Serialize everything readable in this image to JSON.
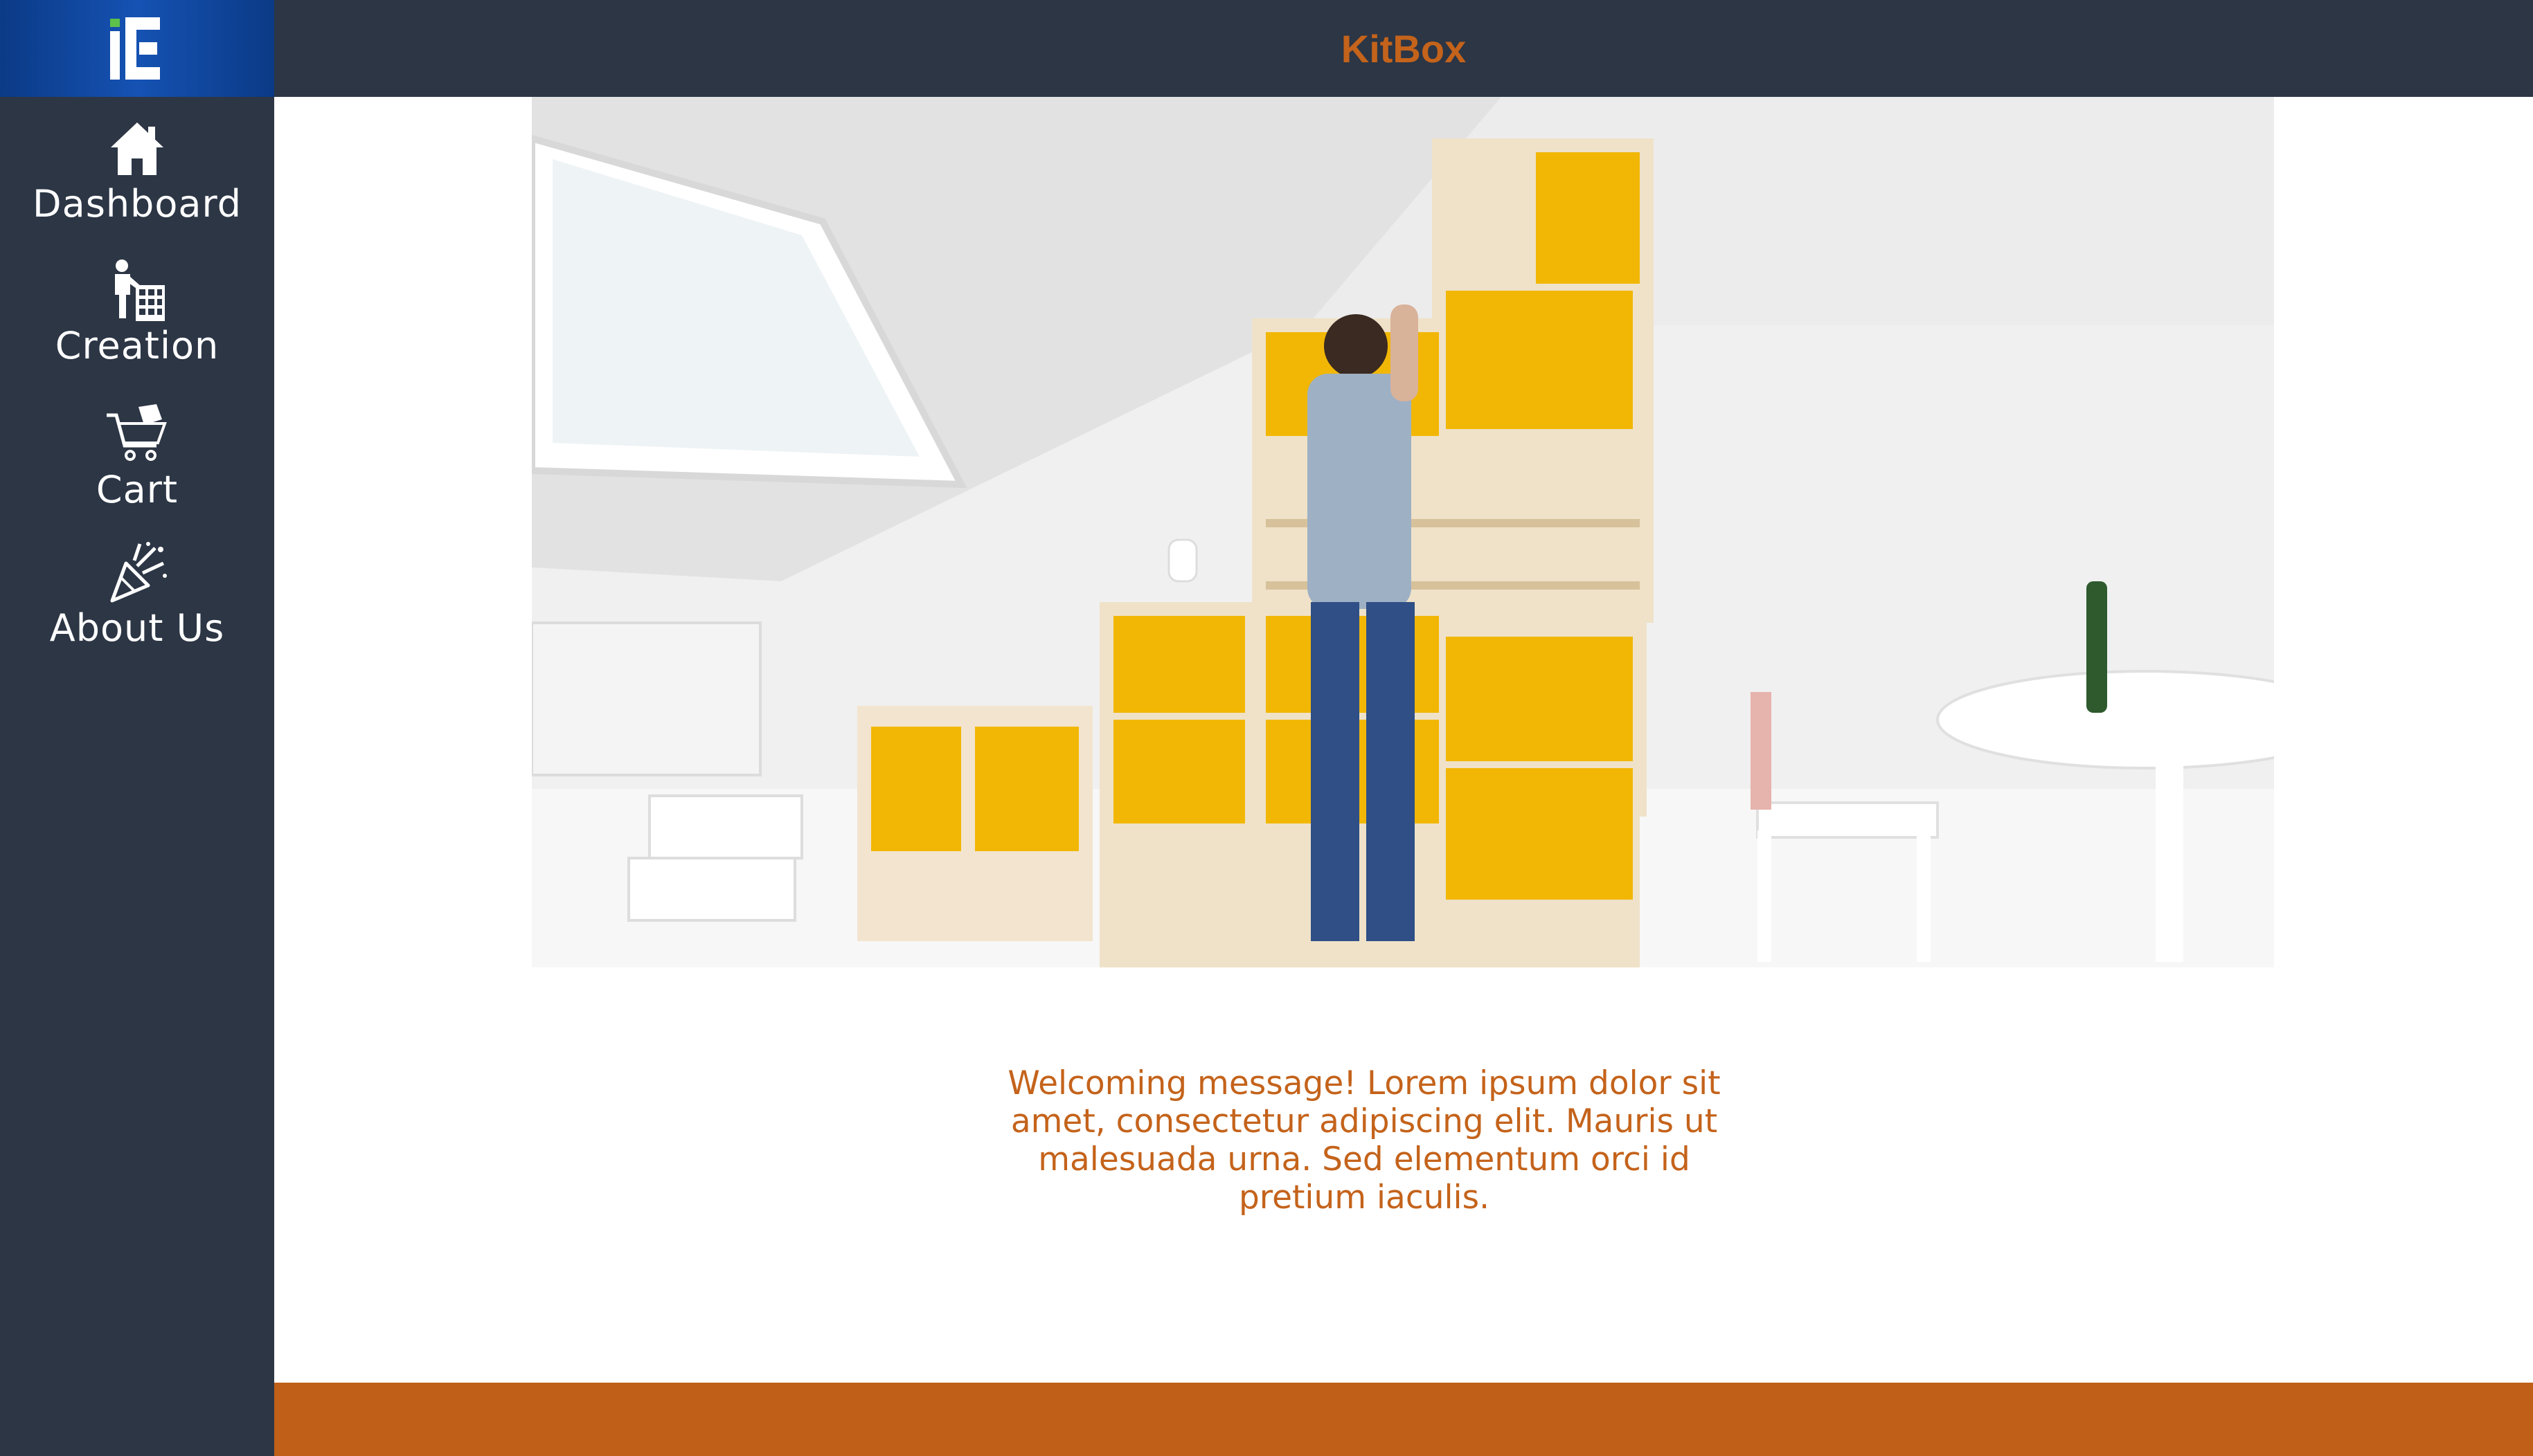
{
  "app": {
    "title": "KitBox"
  },
  "sidebar": {
    "items": [
      {
        "label": "Dashboard",
        "icon": "home-icon"
      },
      {
        "label": "Creation",
        "icon": "person-cabinet-icon"
      },
      {
        "label": "Cart",
        "icon": "cart-icon"
      },
      {
        "label": "About Us",
        "icon": "party-popper-icon"
      }
    ]
  },
  "main": {
    "hero_image": "person-assembling-yellow-shelving-photo",
    "welcome_text": "Welcoming message! Lorem ipsum dolor sit amet, consectetur adipiscing elit. Mauris ut malesuada urna. Sed elementum orci id pretium iaculis."
  },
  "colors": {
    "sidebar_bg": "#2c3645",
    "accent_orange": "#c4631b",
    "footer_orange": "#c05f17",
    "logo_blue": "#1552b3",
    "cabinet_yellow": "#f2b705"
  }
}
